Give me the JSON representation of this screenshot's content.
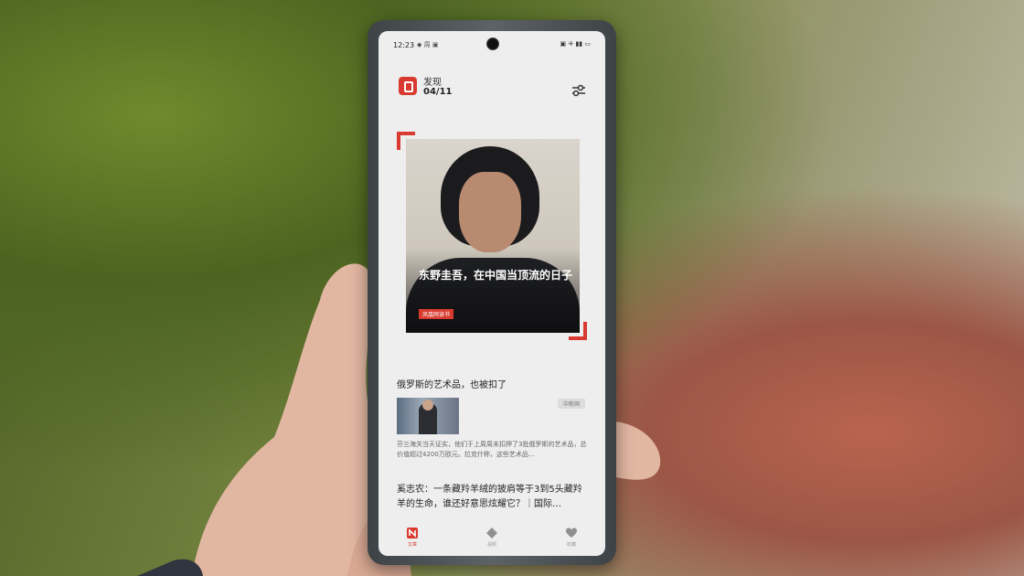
{
  "status_bar": {
    "time": "12:23",
    "left_icons": "◆ 周 ▣",
    "right_icons": "▣ ⁜ ▮▮ ▭"
  },
  "header": {
    "title": "发现",
    "count": "04/11"
  },
  "hero": {
    "title": "东野圭吾，在中国当顶流的日子",
    "badge": "凤凰网读书"
  },
  "articles": [
    {
      "title": "俄罗斯的艺术品，也被扣了",
      "tag": "中新网",
      "snippet": "芬兰海关当天证实，他们于上周周末扣押了3批俄罗斯的艺术品，总价值超过4200万欧元。拉克什称，这些艺术品…"
    },
    {
      "title": "奚志农：一条藏羚羊绒的披肩等于3到5头藏羚羊的生命，谁还好意思炫耀它？｜国际…"
    }
  ],
  "nav": [
    {
      "label": "文章",
      "icon": "n-logo-icon",
      "active": true
    },
    {
      "label": "视频",
      "icon": "diamond-icon",
      "active": false
    },
    {
      "label": "收藏",
      "icon": "heart-icon",
      "active": false
    }
  ],
  "colors": {
    "accent": "#d93a2f",
    "screen_bg": "#eeeeef"
  }
}
